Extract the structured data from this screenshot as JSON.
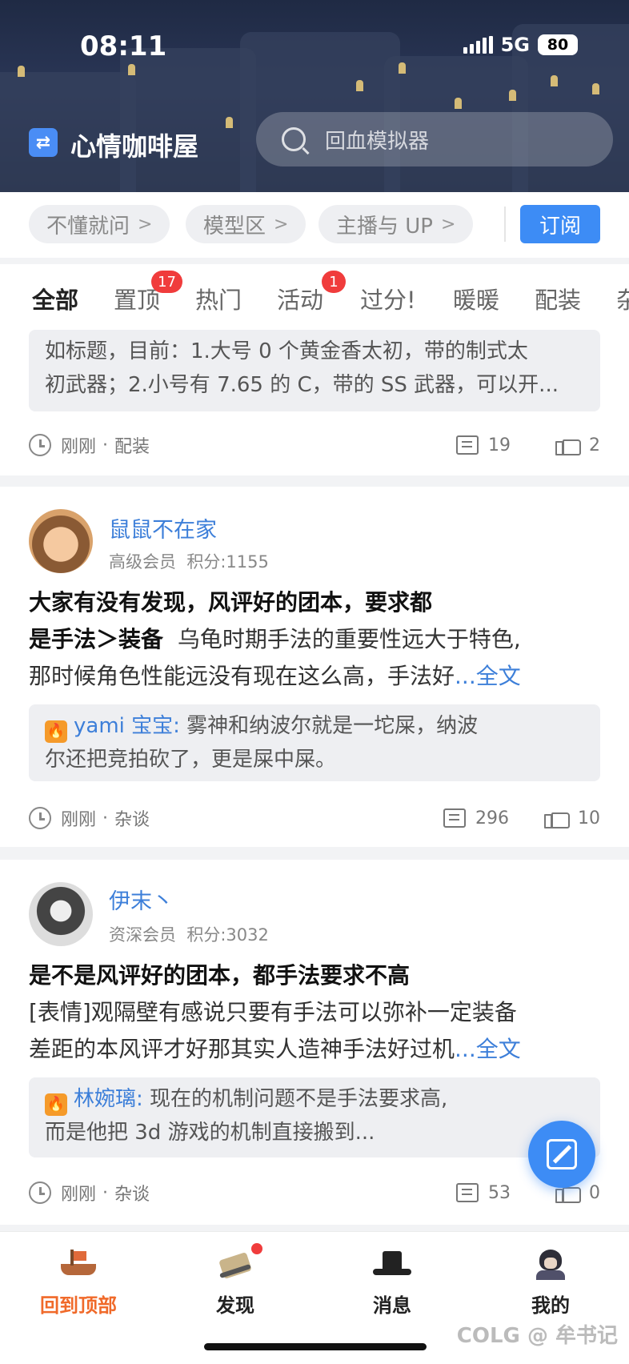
{
  "status_bar": {
    "time": "08:11",
    "network": "5G",
    "battery": "80"
  },
  "header": {
    "app_logo": "⇄",
    "title": "心情咖啡屋",
    "search_placeholder": "回血模拟器"
  },
  "categories": {
    "chips": [
      "不懂就问",
      "模型区",
      "主播与 UP"
    ],
    "subscribe_label": "订阅"
  },
  "tabs": [
    {
      "label": "全部",
      "active": true
    },
    {
      "label": "置顶",
      "badge": "17"
    },
    {
      "label": "热门"
    },
    {
      "label": "活动",
      "badge": "1"
    },
    {
      "label": "过分!"
    },
    {
      "label": "暖暖"
    },
    {
      "label": "配装"
    },
    {
      "label": "杂"
    }
  ],
  "posts": [
    {
      "excerpt_line1": "如标题，目前：1.大号 0 个黄金香太初，带的制式太",
      "excerpt_line2": "初武器；2.小号有 7.65 的 C，带的 SS 武器，可以开...",
      "time": "刚刚",
      "board": "配装",
      "comments": "19",
      "likes": "2"
    },
    {
      "username": "鼠鼠不在家",
      "level": "高级会员",
      "points": "积分:1155",
      "title_line1": "大家有没有发现，风评好的团本，要求都",
      "title_line2": "是手法＞装备",
      "body_line2": "乌龟时期手法的重要性远大于特色,",
      "body_line3": "那时候角色性能远没有现在这么高，手法好",
      "more_label": "...全文",
      "reply_name": "yami 宝宝:",
      "reply_line1": "雾神和纳波尔就是一坨屎，纳波",
      "reply_line2": "尔还把竞拍砍了，更是屎中屎。",
      "time": "刚刚",
      "board": "杂谈",
      "comments": "296",
      "likes": "10"
    },
    {
      "username": "伊末丶",
      "level": "资深会员",
      "points": "积分:3032",
      "title": "是不是风评好的团本，都手法要求不高",
      "body_line1": "[表情]观隔壁有感说只要有手法可以弥补一定装备",
      "body_line2": "差距的本风评才好那其实人造神手法好过机",
      "more_label": "...全文",
      "reply_name": "林婉璃:",
      "reply_line1": "现在的机制问题不是手法要求高,",
      "reply_line2": "而是他把 3d 游戏的机制直接搬到...",
      "time": "刚刚",
      "board": "杂谈",
      "comments": "53",
      "likes": "0"
    }
  ],
  "separator": "·",
  "fire_glyph": "🔥",
  "bottom_nav": [
    {
      "label": "回到顶部",
      "active": true
    },
    {
      "label": "发现",
      "dot": true
    },
    {
      "label": "消息"
    },
    {
      "label": "我的"
    }
  ],
  "watermark": "COLG @ 牟书记",
  "colors": {
    "accent": "#3d8cf5",
    "link": "#3d7fd9",
    "active_nav": "#f06a2a",
    "badge": "#f03c3c"
  }
}
